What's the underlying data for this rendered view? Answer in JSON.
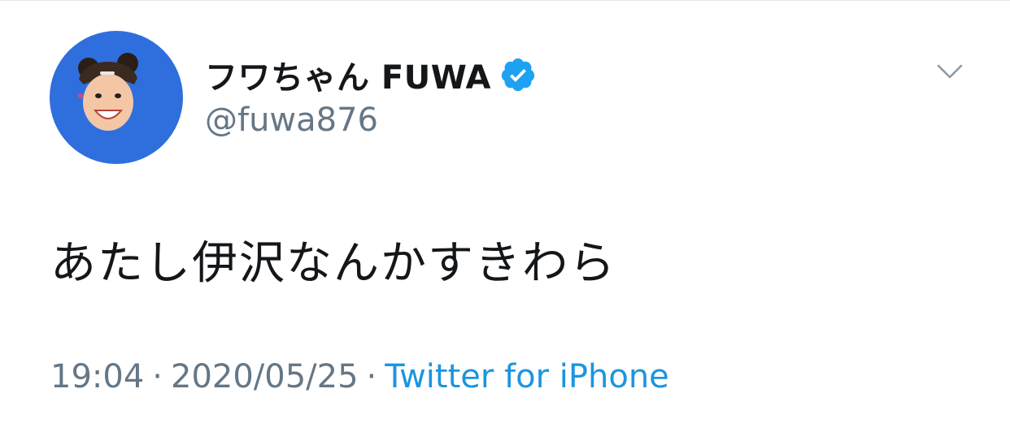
{
  "tweet": {
    "display_name": "フワちゃん FUWA",
    "handle": "@fuwa876",
    "verified": true,
    "text": "あたし伊沢なんかすきわら",
    "time": "19:04",
    "separator": "·",
    "date": "2020/05/25",
    "source": "Twitter for iPhone"
  },
  "icons": {
    "verified": "verified-badge-icon",
    "caret": "chevron-down-icon",
    "avatar": "profile-photo"
  },
  "colors": {
    "avatar_bg": "#2f6fdd",
    "verified": "#1da1f2",
    "link": "#1b95e0",
    "secondary_text": "#657786",
    "primary_text": "#14171a"
  }
}
